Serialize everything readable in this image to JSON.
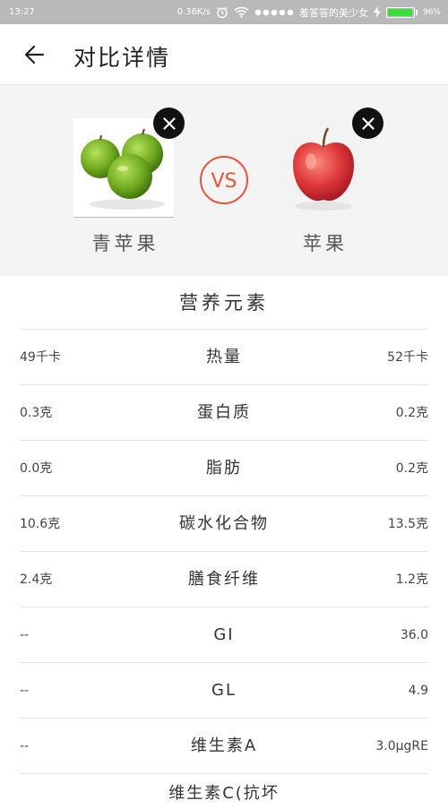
{
  "status_bar": {
    "time": "13:27",
    "speed": "0.36K/s",
    "carrier": "羞答答的美少女",
    "battery_percent": "96%",
    "battery_level": 0.96
  },
  "header": {
    "title": "对比详情"
  },
  "compare": {
    "left": {
      "name": "青苹果",
      "image": "green-apples"
    },
    "right": {
      "name": "苹果",
      "image": "red-apple"
    },
    "vs_label": "VS"
  },
  "nutrition": {
    "section_title": "营养元素",
    "rows": [
      {
        "name": "热量",
        "left": "49千卡",
        "right": "52千卡"
      },
      {
        "name": "蛋白质",
        "left": "0.3克",
        "right": "0.2克"
      },
      {
        "name": "脂肪",
        "left": "0.0克",
        "right": "0.2克"
      },
      {
        "name": "碳水化合物",
        "left": "10.6克",
        "right": "13.5克"
      },
      {
        "name": "膳食纤维",
        "left": "2.4克",
        "right": "1.2克"
      },
      {
        "name": "GI",
        "left": "--",
        "right": "36.0"
      },
      {
        "name": "GL",
        "left": "--",
        "right": "4.9"
      },
      {
        "name": "维生素A",
        "left": "--",
        "right": "3.0μgRE"
      },
      {
        "name": "维生素C(抗坏",
        "left": "",
        "right": ""
      }
    ]
  },
  "colors": {
    "status_bar": "#b9b9b9",
    "header_bg": "#f4f4f4",
    "vs_accent": "#e2553a",
    "battery": "#3ddc3d"
  }
}
